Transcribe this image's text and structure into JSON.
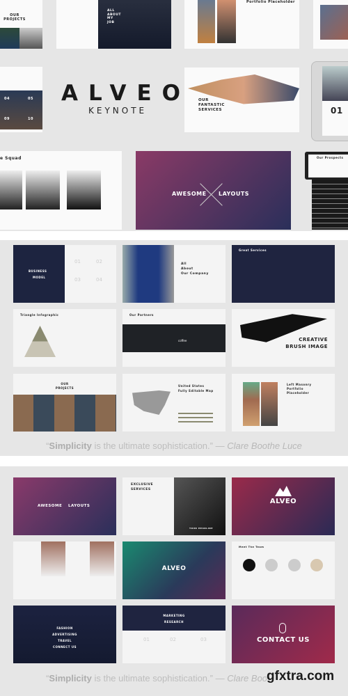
{
  "hero": {
    "brand": "ALVEO",
    "subtitle": "KEYNOTE"
  },
  "top_slides": {
    "our_projects": "OUR PROJECTS",
    "all_about_my_job": "ALL ABOUT MY JOB",
    "portfolio_placeholder": "Portfolio Placeholder",
    "hex_numbers": [
      "04",
      "05",
      "09",
      "10"
    ],
    "fantastic_services": "OUR FANTASTIC SERVICES",
    "tablet_number": "01",
    "squad": "e Squad",
    "awesome_left": "AWESOME",
    "awesome_right": "LAYOUTS",
    "laptop_title": "Our Prospects"
  },
  "grid1": {
    "business_model": [
      "BUSINESS",
      "MODEL"
    ],
    "bm_numbers": [
      "01",
      "02",
      "03",
      "04"
    ],
    "about_company": [
      "All",
      "About",
      "Our Company"
    ],
    "great_services": "Great Services",
    "triangle": "Triangle Infographic",
    "partners": "Our Partners",
    "partner_logos": [
      "coffee"
    ],
    "brush": [
      "CREATIVE",
      "BRUSH IMAGE"
    ],
    "our_projects": [
      "OUR",
      "PROJECTS"
    ],
    "map": [
      "United States",
      "Fully Editable Map"
    ],
    "masonry": [
      "Left Masonry",
      "Portfolio",
      "Placeholder"
    ]
  },
  "grid2": {
    "awesome_left": "AWESOME",
    "awesome_right": "LAYOUTS",
    "exclusive": [
      "EXCLUSIVE",
      "SERVICES"
    ],
    "your_headline": "YOUR HEADLINE",
    "alveo": "ALVEO",
    "alveo_teal": "ALVEO",
    "team": "Meet The Team",
    "menu": [
      "FASHION",
      "ADVERTISING",
      "TRAVEL",
      "CONNECT US"
    ],
    "marketing": [
      "MARKETING",
      "RESEARCH"
    ],
    "mr_numbers": [
      "01",
      "02",
      "03"
    ],
    "contact": "CONTACT US"
  },
  "quote": {
    "bold": "Simplicity",
    "rest": " is the ultimate sophistication.”",
    "dash": " — ",
    "author": "Clare Boothe Luce",
    "open": "“"
  },
  "watermark": "gfxtra.com"
}
